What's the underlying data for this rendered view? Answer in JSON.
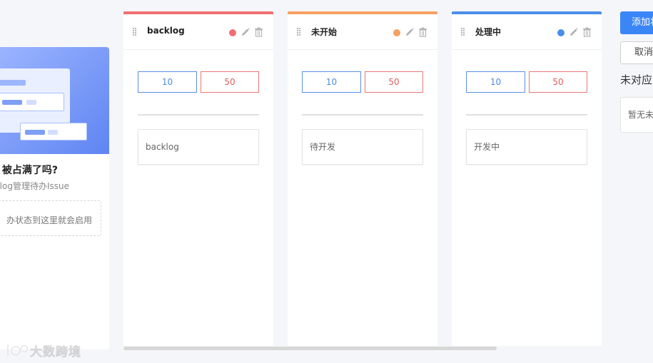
{
  "intro": {
    "title": "被占满了吗?",
    "subtitle": "klog管理待办Issue",
    "drop_hint": "办状态到这里就会启用"
  },
  "columns": [
    {
      "name": "backlog",
      "color": "#f06f73",
      "min_limit": "10",
      "max_limit": "50",
      "status_card": "backlog"
    },
    {
      "name": "未开始",
      "color": "#f7a064",
      "min_limit": "10",
      "max_limit": "50",
      "status_card": "待开发"
    },
    {
      "name": "处理中",
      "color": "#4a8eea",
      "min_limit": "10",
      "max_limit": "50",
      "status_card": "开发中"
    }
  ],
  "right_panel": {
    "add_button": "添加状",
    "cancel_button": "取消",
    "unmatched_title": "未对应",
    "unmatched_empty": "暂无未"
  },
  "watermark": {
    "text": "大数跨境"
  },
  "icons": {
    "drag": "drag-handle-icon",
    "edit": "pencil-icon",
    "delete": "trash-icon"
  }
}
